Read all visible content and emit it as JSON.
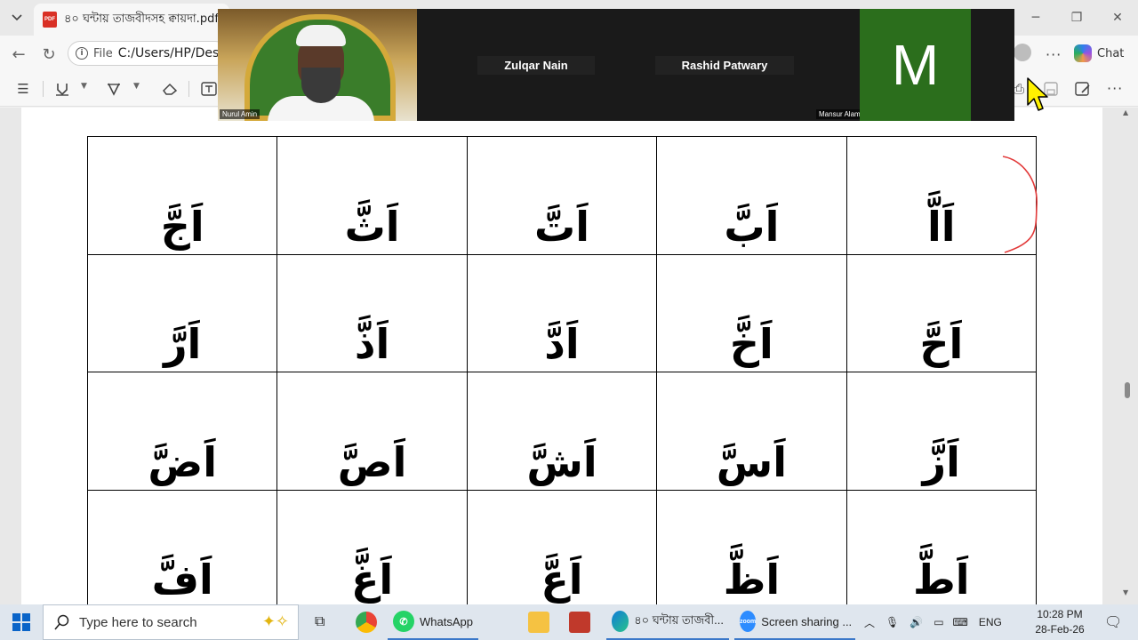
{
  "browser": {
    "tab_title": "৪০ ঘন্টায় তাজবীদসহ ক্বায়দা.pdf",
    "pdf_badge": "PDF",
    "url_scheme": "File",
    "url": "C:/Users/HP/Desk",
    "chat_label": "Chat"
  },
  "zoom": {
    "participants": [
      {
        "name": "Nurul Amin"
      },
      {
        "name": "Zulqar Nain"
      },
      {
        "name": "Rashid Patwary"
      },
      {
        "name": "Mansur Alam"
      }
    ],
    "avatar_letter": "M"
  },
  "document": {
    "rows": [
      [
        "اَجَّ",
        "اَثَّ",
        "اَتَّ",
        "اَبَّ",
        "اَاَّ"
      ],
      [
        "اَرَّ",
        "اَذَّ",
        "اَدَّ",
        "اَخَّ",
        "اَحَّ"
      ],
      [
        "اَضَّ",
        "اَصَّ",
        "اَشَّ",
        "اَسَّ",
        "اَزَّ"
      ],
      [
        "اَفَّ",
        "اَغَّ",
        "اَعَّ",
        "اَظَّ",
        "اَطَّ"
      ]
    ]
  },
  "taskbar": {
    "search_placeholder": "Type here to search",
    "apps": [
      {
        "label": "WhatsApp"
      },
      {
        "label": "৪০ ঘন্টায় তাজবী..."
      },
      {
        "label": "Screen sharing ..."
      }
    ],
    "zoom_badge": "zoom",
    "language": "ENG",
    "time": "10:28 PM",
    "date": "28-Feb-26"
  }
}
